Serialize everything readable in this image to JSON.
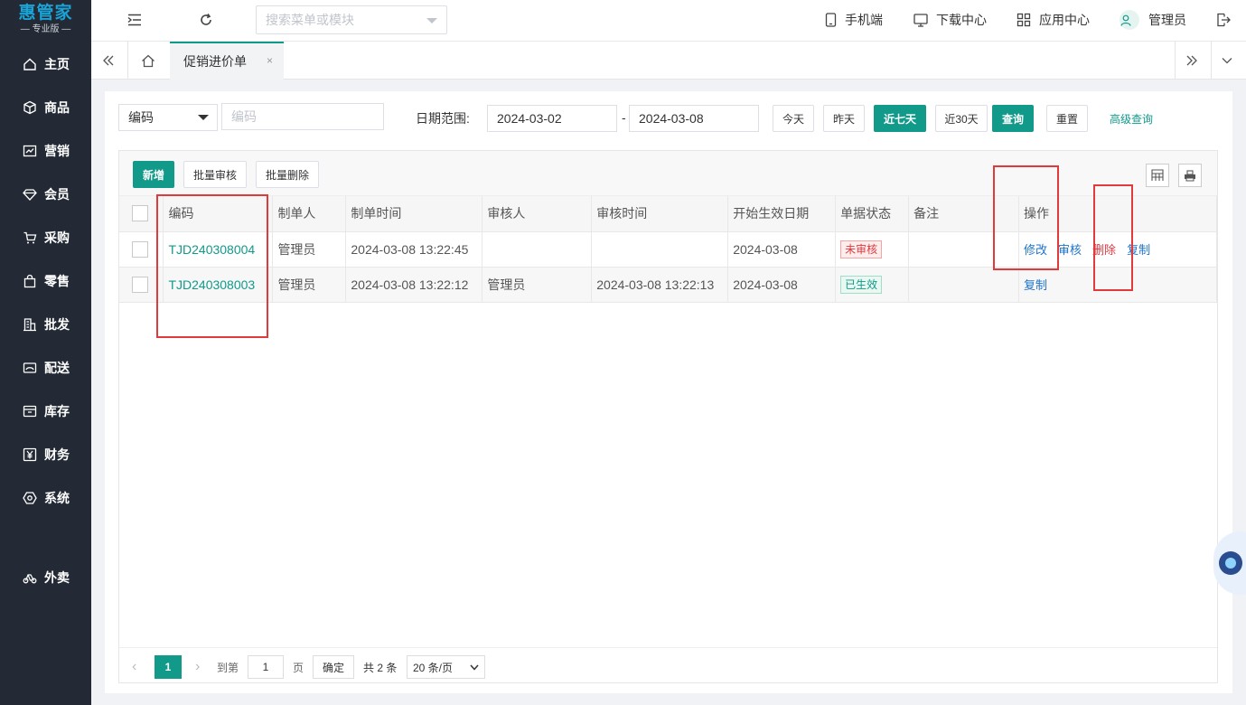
{
  "app": {
    "logo_main": "惠管家",
    "logo_sub": "— 专业版 —"
  },
  "sidebar": {
    "items": [
      {
        "label": "主页",
        "icon": "home-icon"
      },
      {
        "label": "商品",
        "icon": "cube-icon"
      },
      {
        "label": "营销",
        "icon": "chart-icon"
      },
      {
        "label": "会员",
        "icon": "diamond-icon"
      },
      {
        "label": "采购",
        "icon": "cart-icon"
      },
      {
        "label": "零售",
        "icon": "bag-icon"
      },
      {
        "label": "批发",
        "icon": "building-icon"
      },
      {
        "label": "配送",
        "icon": "truck-icon"
      },
      {
        "label": "库存",
        "icon": "box-icon"
      },
      {
        "label": "财务",
        "icon": "yen-icon"
      },
      {
        "label": "系统",
        "icon": "settings-icon"
      },
      {
        "label": "外卖",
        "icon": "bike-icon"
      }
    ]
  },
  "header": {
    "search_placeholder": "搜索菜单或模块",
    "mobile": "手机端",
    "download": "下载中心",
    "apps": "应用中心",
    "user": "管理员"
  },
  "tabs": {
    "active": "促销进价单",
    "close": "×"
  },
  "filters": {
    "field_select": "编码",
    "code_placeholder": "编码",
    "date_label": "日期范围:",
    "date_start": "2024-03-02",
    "date_sep": "-",
    "date_end": "2024-03-08",
    "today": "今天",
    "yesterday": "昨天",
    "last7": "近七天",
    "last30": "近30天",
    "query": "查询",
    "reset": "重置",
    "advanced": "高级查询"
  },
  "toolbar": {
    "add": "新增",
    "batch_review": "批量审核",
    "batch_delete": "批量删除"
  },
  "table": {
    "headers": [
      "编码",
      "制单人",
      "制单时间",
      "审核人",
      "审核时间",
      "开始生效日期",
      "单据状态",
      "备注",
      "操作"
    ],
    "rows": [
      {
        "code": "TJD240308004",
        "creator": "管理员",
        "created": "2024-03-08 13:22:45",
        "reviewer": "",
        "reviewed": "",
        "start": "2024-03-08",
        "status": "未审核",
        "note": "",
        "ops": [
          "修改",
          "审核",
          "删除",
          "复制"
        ]
      },
      {
        "code": "TJD240308003",
        "creator": "管理员",
        "created": "2024-03-08 13:22:12",
        "reviewer": "管理员",
        "reviewed": "2024-03-08 13:22:13",
        "start": "2024-03-08",
        "status": "已生效",
        "note": "",
        "ops": [
          "复制"
        ]
      }
    ]
  },
  "pager": {
    "current": "1",
    "goto": "到第",
    "page_input": "1",
    "page_unit": "页",
    "confirm": "确定",
    "total": "共 2 条",
    "page_size": "20 条/页"
  },
  "colors": {
    "accent": "#11998a",
    "sidebar_bg": "#232a35",
    "danger": "#e0383e",
    "link": "#1e73c8",
    "annotation": "#e03a3a"
  }
}
